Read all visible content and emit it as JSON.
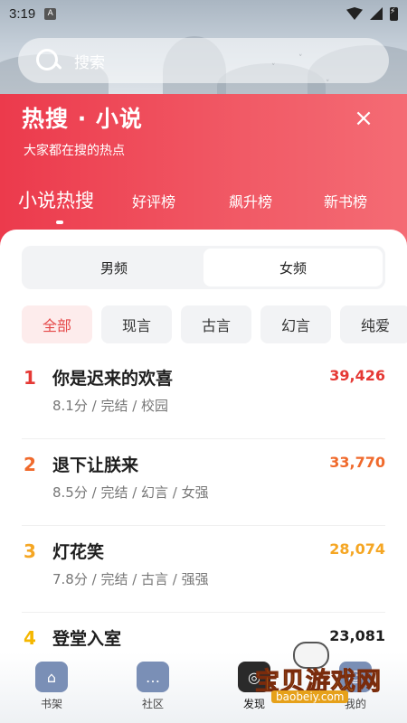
{
  "status_bar": {
    "time": "3:19",
    "notification_badge": "A"
  },
  "search": {
    "placeholder": "搜索"
  },
  "header": {
    "title": "热搜 · 小说",
    "subtitle": "大家都在搜的热点",
    "close_icon": "×"
  },
  "category_tabs": [
    {
      "label": "小说热搜",
      "active": true
    },
    {
      "label": "好评榜",
      "active": false
    },
    {
      "label": "飙升榜",
      "active": false
    },
    {
      "label": "新书榜",
      "active": false
    }
  ],
  "gender": {
    "male": "男频",
    "female": "女频",
    "selected": "女频"
  },
  "genres": [
    {
      "label": "全部",
      "active": true
    },
    {
      "label": "现言",
      "active": false
    },
    {
      "label": "古言",
      "active": false
    },
    {
      "label": "幻言",
      "active": false
    },
    {
      "label": "纯爱",
      "active": false
    }
  ],
  "rankings": [
    {
      "rank": "1",
      "title": "你是迟来的欢喜",
      "meta": "8.1分 / 完结 / 校园",
      "score": "39,426",
      "color": "#e53935"
    },
    {
      "rank": "2",
      "title": "退下让朕来",
      "meta": "8.5分 / 完结 / 幻言 / 女强",
      "score": "33,770",
      "color": "#f06a2c"
    },
    {
      "rank": "3",
      "title": "灯花笑",
      "meta": "7.8分 / 完结 / 古言 / 强强",
      "score": "28,074",
      "color": "#f5a623"
    },
    {
      "rank": "4",
      "title": "登堂入室",
      "meta": "",
      "score": "23,081",
      "color": "#f5b700"
    }
  ],
  "bottom_nav": [
    {
      "label": "书架",
      "icon": "home-icon"
    },
    {
      "label": "社区",
      "icon": "chat-icon"
    },
    {
      "label": "发现",
      "icon": "discover-icon"
    },
    {
      "label": "我的",
      "icon": "profile-icon"
    }
  ],
  "watermark": {
    "text": "宝贝游戏网",
    "url": "baobeiy.com"
  },
  "colors": {
    "accent_red": "#ec3a4c",
    "chip_active_bg": "#fdecec",
    "chip_active_text": "#e54848"
  }
}
